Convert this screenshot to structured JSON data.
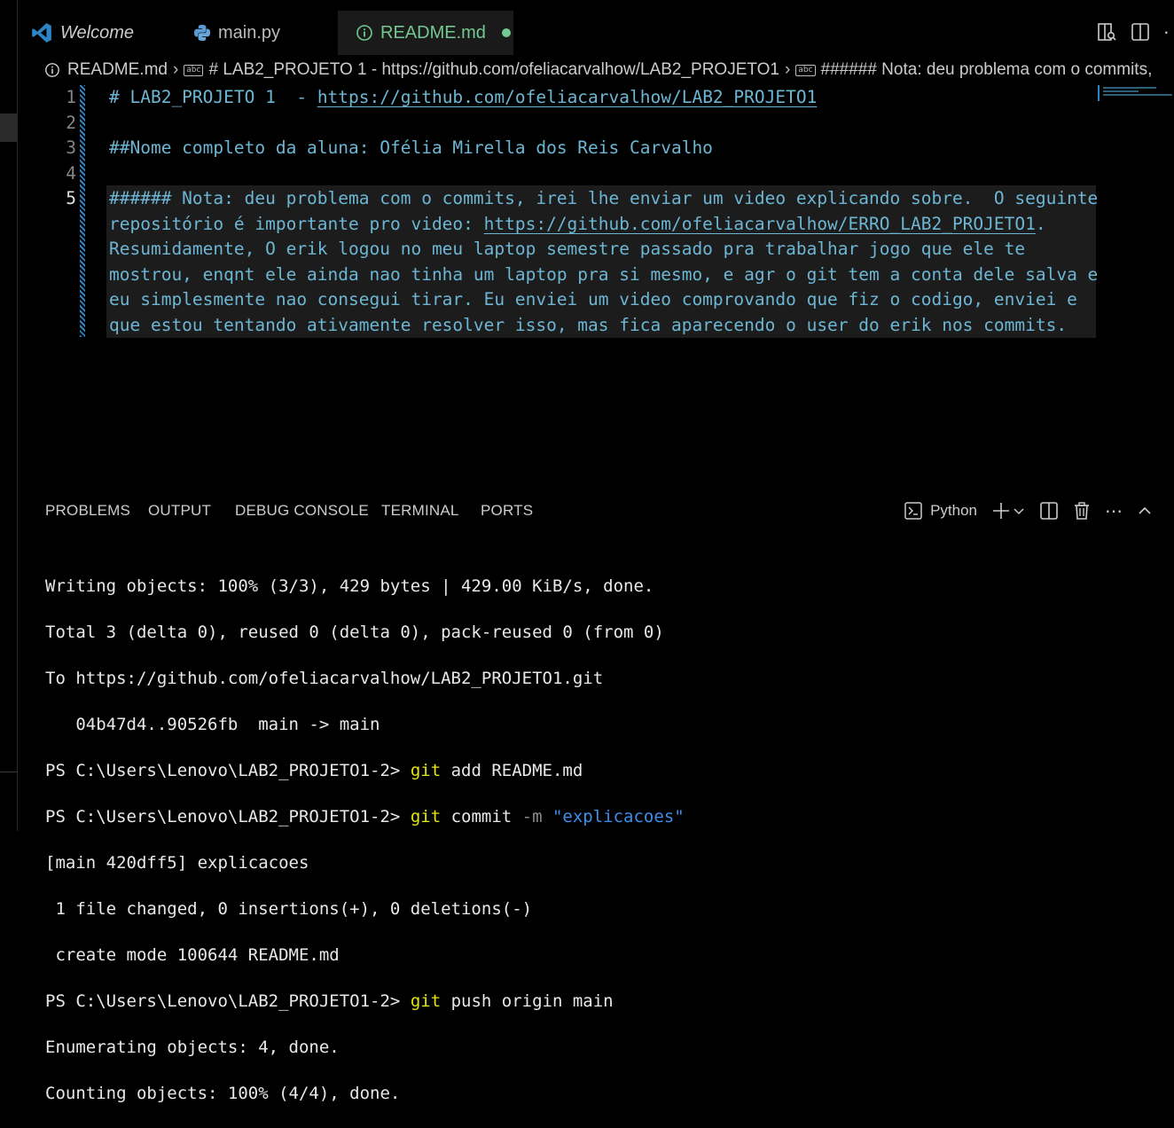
{
  "tabs": {
    "welcome": "Welcome",
    "main": "main.py",
    "readme": "README.md"
  },
  "breadcrumb": {
    "file": "README.md",
    "section1": "# LAB2_PROJETO 1  - https://github.com/ofeliacarvalhow/LAB2_PROJETO1",
    "section2": "###### Nota: deu problema com o commits,"
  },
  "editor": {
    "line_numbers": [
      "1",
      "2",
      "3",
      "4",
      "5"
    ],
    "line1_prefix": "# LAB2_PROJETO 1  - ",
    "line1_link": "https://github.com/ofeliacarvalhow/LAB2_PROJETO1",
    "line3": "##Nome completo da aluna: Ofélia Mirella dos Reis Carvalho",
    "line5_a": "###### Nota: deu problema com o commits, irei lhe enviar um video explicando sobre.  O seguinte",
    "line5_b_prefix": "repositório é importante pro video: ",
    "line5_b_link": "https://github.com/ofeliacarvalhow/ERRO_LAB2_PROJETO1",
    "line5_b_suffix": ".",
    "line5_c": "Resumidamente, O erik logou no meu laptop semestre passado pra trabalhar jogo que ele te",
    "line5_d": "mostrou, enqnt ele ainda nao tinha um laptop pra si mesmo, e agr o git tem a conta dele salva e",
    "line5_e": "eu simplesmente nao consegui tirar. Eu enviei um video comprovando que fiz o codigo, enviei e",
    "line5_f": "que estou tentando ativamente resolver isso, mas fica aparecendo o user do erik nos commits."
  },
  "panel": {
    "tabs": [
      "PROBLEMS",
      "OUTPUT",
      "DEBUG CONSOLE",
      "TERMINAL",
      "PORTS"
    ],
    "terminal_name": "Python"
  },
  "terminal": {
    "l1": "Writing objects: 100% (3/3), 429 bytes | 429.00 KiB/s, done.",
    "l2": "Total 3 (delta 0), reused 0 (delta 0), pack-reused 0 (from 0)",
    "l3": "To https://github.com/ofeliacarvalhow/LAB2_PROJETO1.git",
    "l4": "   04b47d4..90526fb  main -> main",
    "prompt": "PS C:\\Users\\Lenovo\\LAB2_PROJETO1-2> ",
    "cmd1_git": "git",
    "cmd1_rest": " add README.md",
    "cmd2_git": "git",
    "cmd2_mid": " commit ",
    "cmd2_flag": "-m",
    "cmd2_str": " \"explicacoes\"",
    "l7": "[main 420dff5] explicacoes",
    "l8": " 1 file changed, 0 insertions(+), 0 deletions(-)",
    "l9": " create mode 100644 README.md",
    "cmd3_git": "git",
    "cmd3_rest": " push origin main",
    "l11": "Enumerating objects: 4, done.",
    "l12": "Counting objects: 100% (4/4), done."
  },
  "colors": {
    "accent_blue": "#2d84c5",
    "modified_green": "#73c991",
    "code_text": "#6cb6d4",
    "git_yellow": "#e5e510"
  }
}
